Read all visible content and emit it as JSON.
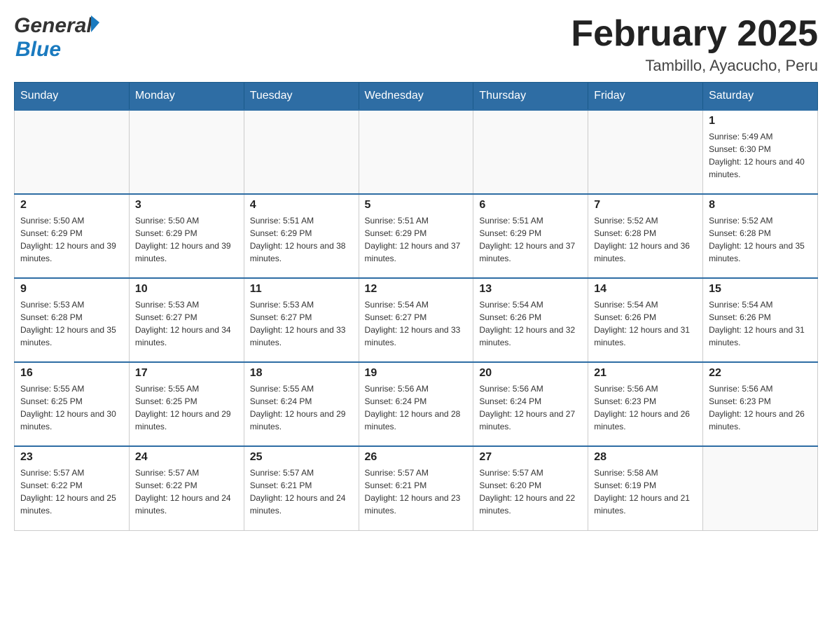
{
  "header": {
    "logo_general": "General",
    "logo_blue": "Blue",
    "month_title": "February 2025",
    "location": "Tambillo, Ayacucho, Peru"
  },
  "days_of_week": [
    "Sunday",
    "Monday",
    "Tuesday",
    "Wednesday",
    "Thursday",
    "Friday",
    "Saturday"
  ],
  "weeks": [
    [
      {
        "day": "",
        "info": ""
      },
      {
        "day": "",
        "info": ""
      },
      {
        "day": "",
        "info": ""
      },
      {
        "day": "",
        "info": ""
      },
      {
        "day": "",
        "info": ""
      },
      {
        "day": "",
        "info": ""
      },
      {
        "day": "1",
        "info": "Sunrise: 5:49 AM\nSunset: 6:30 PM\nDaylight: 12 hours and 40 minutes."
      }
    ],
    [
      {
        "day": "2",
        "info": "Sunrise: 5:50 AM\nSunset: 6:29 PM\nDaylight: 12 hours and 39 minutes."
      },
      {
        "day": "3",
        "info": "Sunrise: 5:50 AM\nSunset: 6:29 PM\nDaylight: 12 hours and 39 minutes."
      },
      {
        "day": "4",
        "info": "Sunrise: 5:51 AM\nSunset: 6:29 PM\nDaylight: 12 hours and 38 minutes."
      },
      {
        "day": "5",
        "info": "Sunrise: 5:51 AM\nSunset: 6:29 PM\nDaylight: 12 hours and 37 minutes."
      },
      {
        "day": "6",
        "info": "Sunrise: 5:51 AM\nSunset: 6:29 PM\nDaylight: 12 hours and 37 minutes."
      },
      {
        "day": "7",
        "info": "Sunrise: 5:52 AM\nSunset: 6:28 PM\nDaylight: 12 hours and 36 minutes."
      },
      {
        "day": "8",
        "info": "Sunrise: 5:52 AM\nSunset: 6:28 PM\nDaylight: 12 hours and 35 minutes."
      }
    ],
    [
      {
        "day": "9",
        "info": "Sunrise: 5:53 AM\nSunset: 6:28 PM\nDaylight: 12 hours and 35 minutes."
      },
      {
        "day": "10",
        "info": "Sunrise: 5:53 AM\nSunset: 6:27 PM\nDaylight: 12 hours and 34 minutes."
      },
      {
        "day": "11",
        "info": "Sunrise: 5:53 AM\nSunset: 6:27 PM\nDaylight: 12 hours and 33 minutes."
      },
      {
        "day": "12",
        "info": "Sunrise: 5:54 AM\nSunset: 6:27 PM\nDaylight: 12 hours and 33 minutes."
      },
      {
        "day": "13",
        "info": "Sunrise: 5:54 AM\nSunset: 6:26 PM\nDaylight: 12 hours and 32 minutes."
      },
      {
        "day": "14",
        "info": "Sunrise: 5:54 AM\nSunset: 6:26 PM\nDaylight: 12 hours and 31 minutes."
      },
      {
        "day": "15",
        "info": "Sunrise: 5:54 AM\nSunset: 6:26 PM\nDaylight: 12 hours and 31 minutes."
      }
    ],
    [
      {
        "day": "16",
        "info": "Sunrise: 5:55 AM\nSunset: 6:25 PM\nDaylight: 12 hours and 30 minutes."
      },
      {
        "day": "17",
        "info": "Sunrise: 5:55 AM\nSunset: 6:25 PM\nDaylight: 12 hours and 29 minutes."
      },
      {
        "day": "18",
        "info": "Sunrise: 5:55 AM\nSunset: 6:24 PM\nDaylight: 12 hours and 29 minutes."
      },
      {
        "day": "19",
        "info": "Sunrise: 5:56 AM\nSunset: 6:24 PM\nDaylight: 12 hours and 28 minutes."
      },
      {
        "day": "20",
        "info": "Sunrise: 5:56 AM\nSunset: 6:24 PM\nDaylight: 12 hours and 27 minutes."
      },
      {
        "day": "21",
        "info": "Sunrise: 5:56 AM\nSunset: 6:23 PM\nDaylight: 12 hours and 26 minutes."
      },
      {
        "day": "22",
        "info": "Sunrise: 5:56 AM\nSunset: 6:23 PM\nDaylight: 12 hours and 26 minutes."
      }
    ],
    [
      {
        "day": "23",
        "info": "Sunrise: 5:57 AM\nSunset: 6:22 PM\nDaylight: 12 hours and 25 minutes."
      },
      {
        "day": "24",
        "info": "Sunrise: 5:57 AM\nSunset: 6:22 PM\nDaylight: 12 hours and 24 minutes."
      },
      {
        "day": "25",
        "info": "Sunrise: 5:57 AM\nSunset: 6:21 PM\nDaylight: 12 hours and 24 minutes."
      },
      {
        "day": "26",
        "info": "Sunrise: 5:57 AM\nSunset: 6:21 PM\nDaylight: 12 hours and 23 minutes."
      },
      {
        "day": "27",
        "info": "Sunrise: 5:57 AM\nSunset: 6:20 PM\nDaylight: 12 hours and 22 minutes."
      },
      {
        "day": "28",
        "info": "Sunrise: 5:58 AM\nSunset: 6:19 PM\nDaylight: 12 hours and 21 minutes."
      },
      {
        "day": "",
        "info": ""
      }
    ]
  ],
  "colors": {
    "header_bg": "#2e6da4",
    "header_text": "#ffffff",
    "border": "#cccccc",
    "day_number": "#222222",
    "day_info": "#333333"
  }
}
